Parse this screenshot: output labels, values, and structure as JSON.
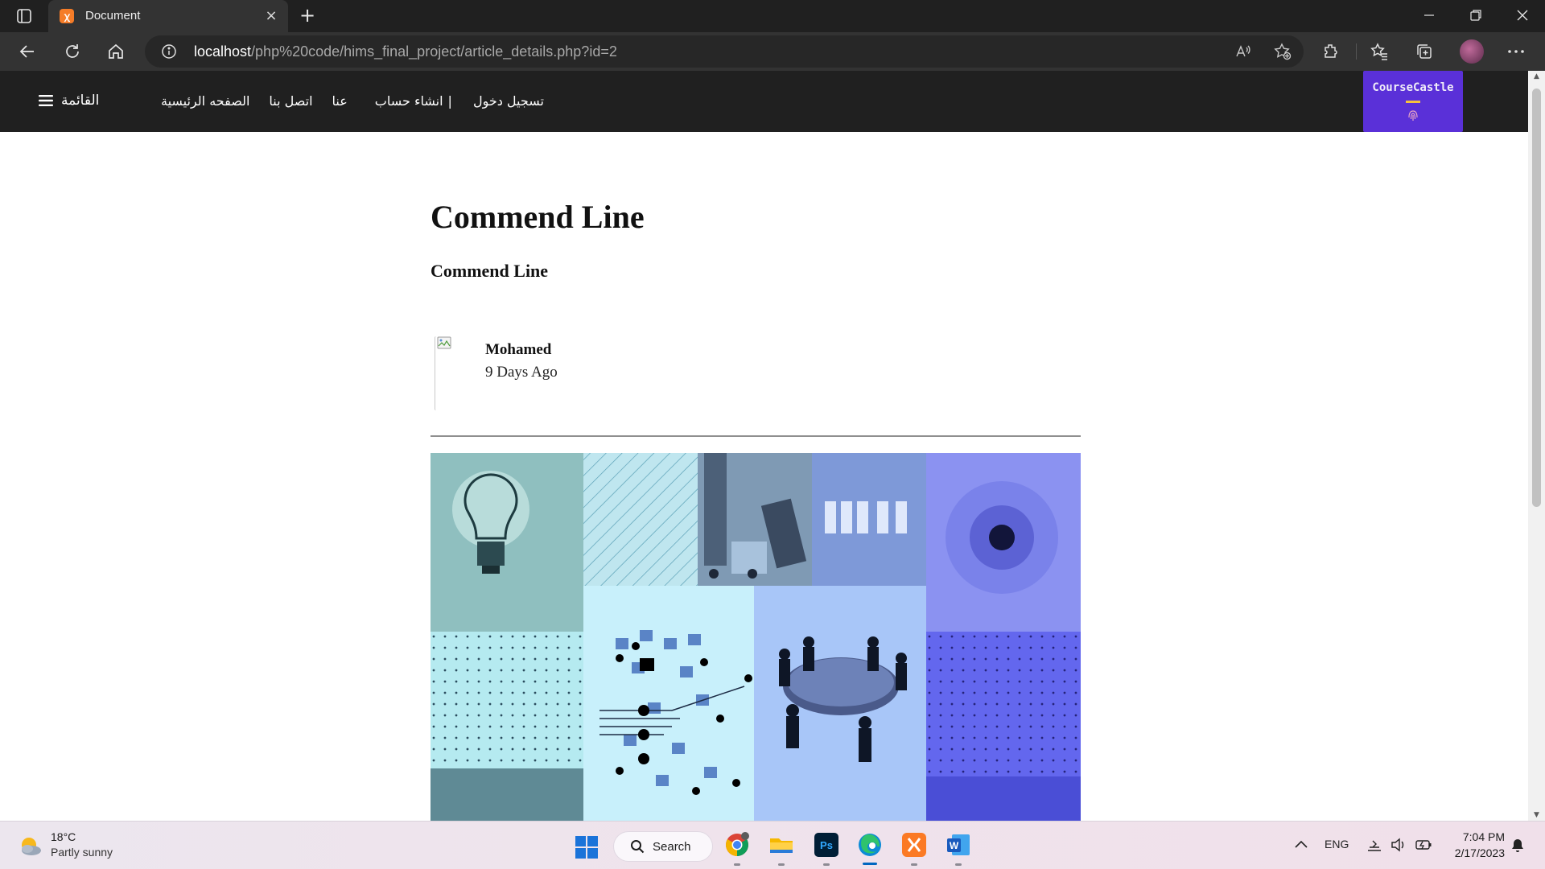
{
  "browser": {
    "tab_title": "Document",
    "url_host": "localhost",
    "url_path": "/php%20code/hims_final_project/article_details.php?id=2"
  },
  "site": {
    "menu_label": "القائمة",
    "nav_links": [
      "الصفحه الرئيسية",
      "اتصل بنا",
      "عنا",
      "انشاء حساب",
      "|",
      "تسجيل دخول"
    ],
    "brand": "CourseCastle",
    "colors": {
      "nav_bg": "#202020",
      "brand_bg": "#5a30d8",
      "brand_accent": "#f6c23e"
    }
  },
  "article": {
    "title": "Commend Line",
    "subtitle": "Commend Line",
    "author": "Mohamed",
    "date": "9 Days Ago",
    "image_icon": "broken-image-icon"
  },
  "taskbar": {
    "weather_temp": "18°C",
    "weather_desc": "Partly sunny",
    "search_label": "Search",
    "language": "ENG",
    "time": "7:04 PM",
    "date": "2/17/2023",
    "apps": [
      "chrome-icon",
      "file-explorer-icon",
      "photoshop-icon",
      "edge-icon",
      "xampp-icon",
      "word-icon"
    ]
  }
}
